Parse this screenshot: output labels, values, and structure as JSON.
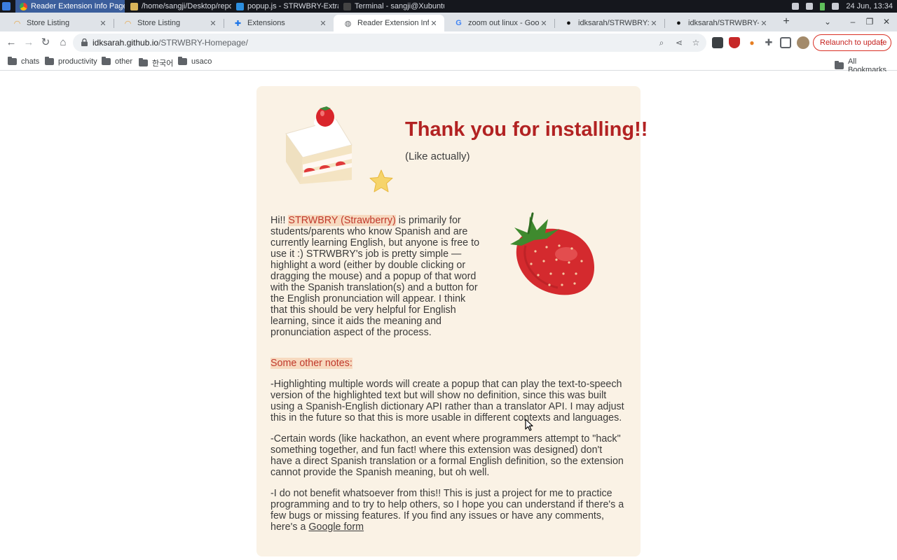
{
  "taskbar": {
    "windows": [
      {
        "title": "Reader Extension Info Page ..."
      },
      {
        "title": "/home/sangji/Desktop/repo..."
      },
      {
        "title": "popup.js - STRWBRY-Extras -..."
      },
      {
        "title": "Terminal - sangji@Xubuntu: ..."
      }
    ],
    "clock": "24 Jun, 13:34"
  },
  "tabs": [
    {
      "title": "Store Listing"
    },
    {
      "title": "Store Listing"
    },
    {
      "title": "Extensions"
    },
    {
      "title": "Reader Extension Info Pa"
    },
    {
      "title": "zoom out linux - Google S"
    },
    {
      "title": "idksarah/STRWBRY: STRW"
    },
    {
      "title": "idksarah/STRWBRY-Hom"
    }
  ],
  "toolbar": {
    "url_host": "idksarah.github.io",
    "url_path": "/STRWBRY-Homepage/",
    "relaunch_label": "Relaunch to update"
  },
  "bookmarks": [
    {
      "label": "chats"
    },
    {
      "label": "productivity"
    },
    {
      "label": "other"
    },
    {
      "label": "한국어"
    },
    {
      "label": "usaco"
    }
  ],
  "all_bookmarks_label": "All Bookmarks",
  "page": {
    "title": "Thank you for installing!!",
    "subtitle": "(Like actually)",
    "intro_prefix": "Hi!! ",
    "intro_highlight": "STRWBRY (Strawberry)",
    "intro_rest": " is primarily for students/parents who know Spanish and are currently learning English, but anyone is free to use it :) STRWBRY's job is pretty simple — highlight a word (either by double clicking or dragging the mouse) and a popup of that word with the Spanish translation(s) and a button for the English pronunciation will appear. I think that this should be very helpful for English learning, since it aids the meaning and pronunciation aspect of the process.",
    "notes_heading": "Some other notes:",
    "note1": "-Highlighting multiple words will create a popup that can play the text-to-speech version of the highlighted text but will show no definition, since this was built using a Spanish-English dictionary API rather than a translator API. I may adjust this in the future so that this is more usable in different contexts and languages.",
    "note2": "-Certain words (like hackathon, an event where programmers attempt to \"hack\" something together, and fun fact! where this extension was designed) don't have a direct Spanish translation or a formal English definition, so the extension cannot provide the Spanish meaning, but oh well.",
    "note3_text": "-I do not benefit whatsoever from this!! This is just a project for me to practice programming and to try to help others, so I hope you can understand if there's a few bugs or missing features. If you find any issues or have any comments, here's a ",
    "note3_link": "Google form"
  },
  "colors": {
    "title": "#b22222",
    "card_bg": "#faf2e5",
    "highlight_bg": "#f7d9bf",
    "highlight_text": "#c0392b"
  }
}
